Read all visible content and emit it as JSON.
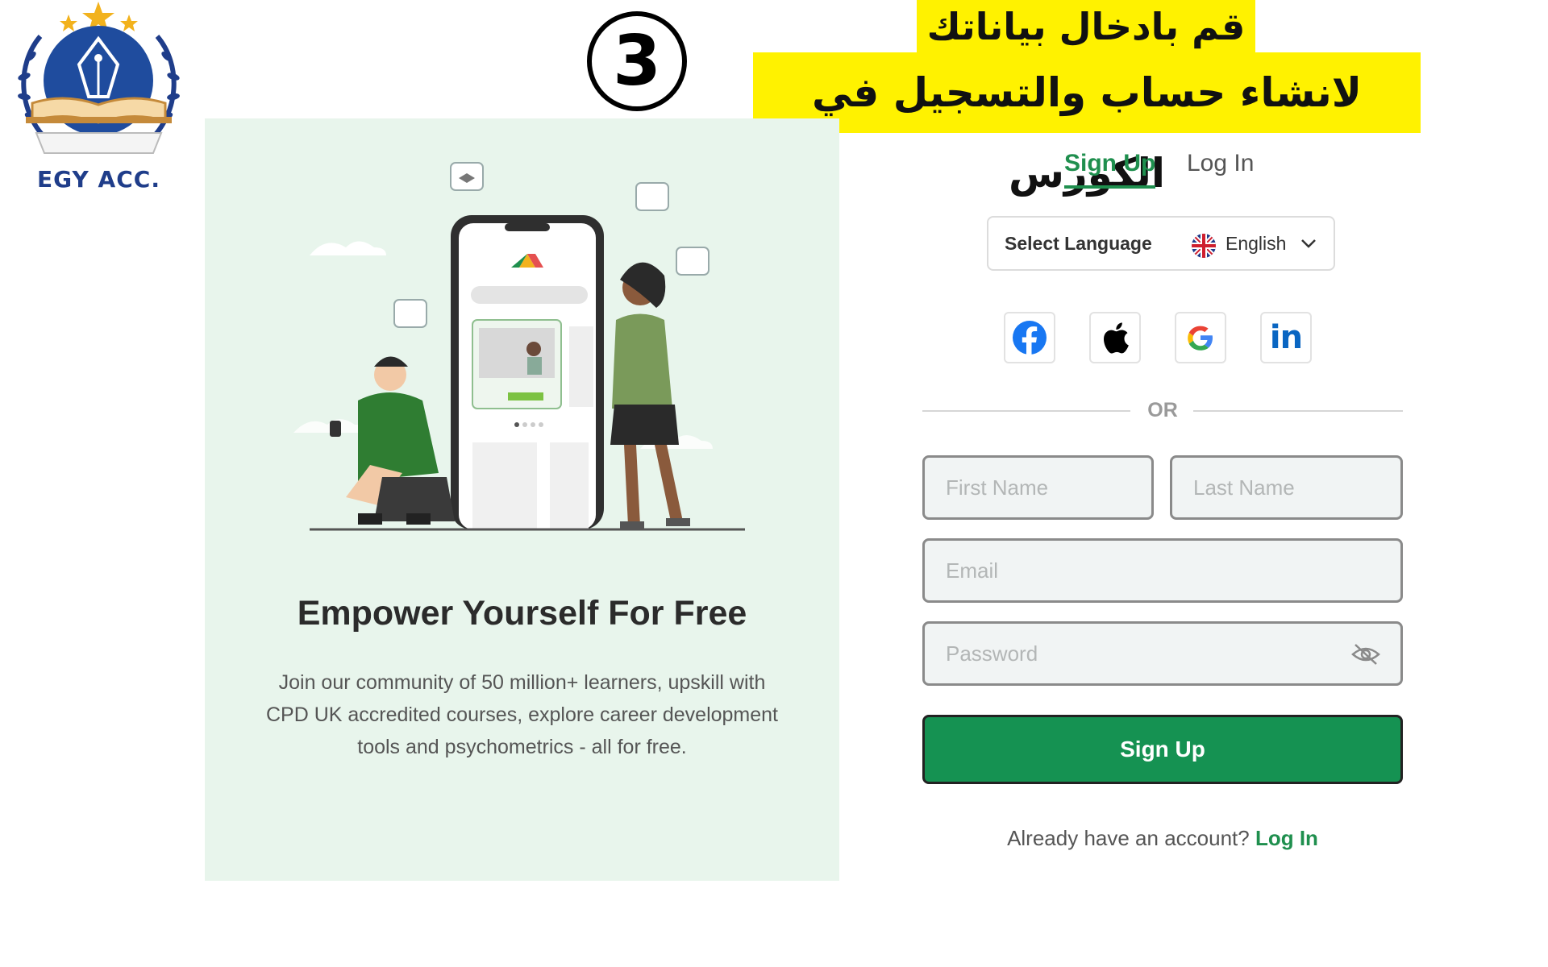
{
  "logo": {
    "text": "EGY ACC."
  },
  "step": {
    "number": "3"
  },
  "banner": {
    "line1": "قم بادخال بياناتك",
    "line2": "لانشاء حساب والتسجيل في الكورس"
  },
  "promo": {
    "title": "Empower Yourself For Free",
    "description": "Join our community of 50 million+ learners, upskill with CPD UK accredited courses, explore career development tools and psychometrics - all for free."
  },
  "auth": {
    "tabs": {
      "signup": "Sign Up",
      "login": "Log In",
      "active": "signup"
    },
    "language": {
      "label": "Select Language",
      "value": "English",
      "flag_icon": "uk-flag-icon"
    },
    "social": [
      {
        "name": "facebook",
        "icon": "facebook-icon",
        "color": "#1877f2"
      },
      {
        "name": "apple",
        "icon": "apple-icon",
        "color": "#000000"
      },
      {
        "name": "google",
        "icon": "google-icon",
        "color": "#4285f4"
      },
      {
        "name": "linkedin",
        "icon": "linkedin-icon",
        "color": "#0a66c2"
      }
    ],
    "divider": "OR",
    "fields": {
      "first_name": {
        "placeholder": "First Name",
        "value": ""
      },
      "last_name": {
        "placeholder": "Last Name",
        "value": ""
      },
      "email": {
        "placeholder": "Email",
        "value": ""
      },
      "password": {
        "placeholder": "Password",
        "value": ""
      }
    },
    "submit_label": "Sign Up",
    "footer": {
      "text": "Already have an account?",
      "link": "Log In"
    }
  },
  "colors": {
    "accent": "#1f8f4e",
    "button": "#159252",
    "panel_bg": "#e8f5ec",
    "banner": "#fff200"
  }
}
